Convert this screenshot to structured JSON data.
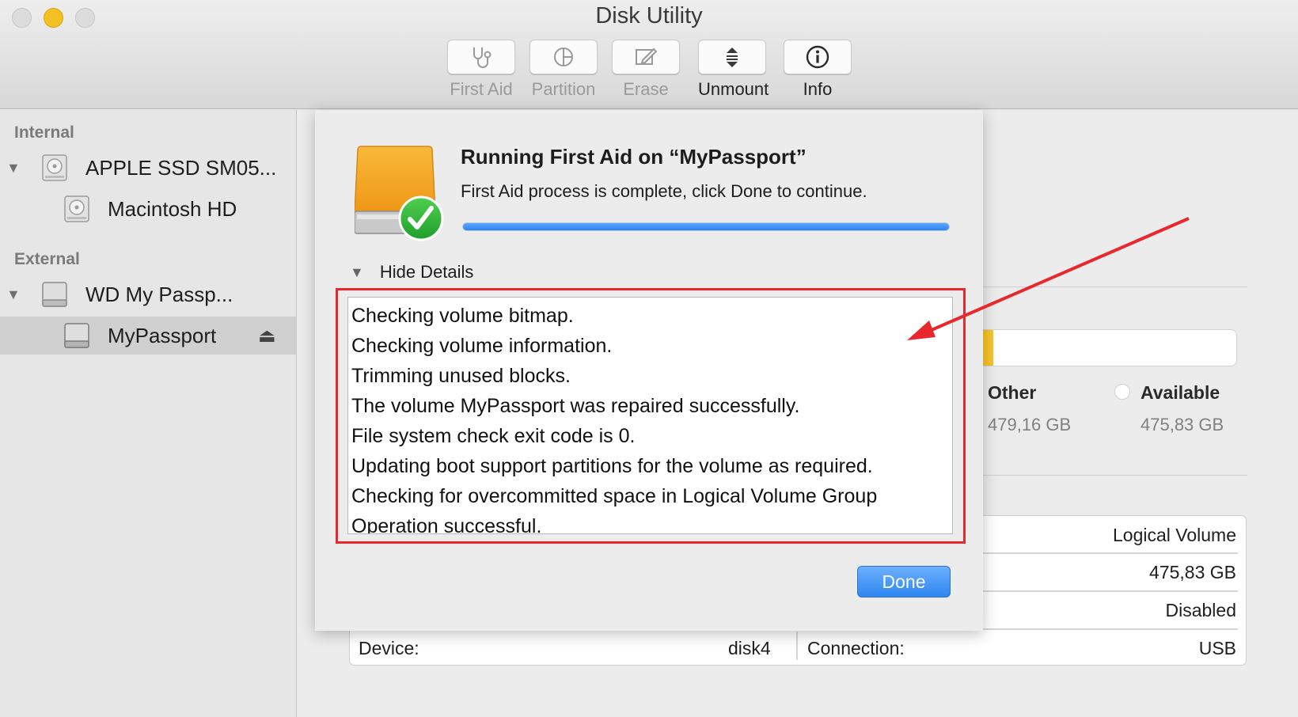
{
  "window": {
    "title": "Disk Utility"
  },
  "toolbar": {
    "items": [
      {
        "label": "First Aid",
        "icon": "stethoscope-icon",
        "enabled": false
      },
      {
        "label": "Partition",
        "icon": "pie-icon",
        "enabled": false
      },
      {
        "label": "Erase",
        "icon": "pencil-icon",
        "enabled": false
      },
      {
        "label": "Unmount",
        "icon": "unmount-icon",
        "enabled": true
      },
      {
        "label": "Info",
        "icon": "info-icon",
        "enabled": true
      }
    ]
  },
  "sidebar": {
    "internal_label": "Internal",
    "external_label": "External",
    "items": [
      {
        "label": "APPLE SSD SM05...",
        "icon": "internal-disk-icon"
      },
      {
        "label": "Macintosh HD",
        "icon": "internal-volume-icon"
      },
      {
        "label": "WD My Passp...",
        "icon": "external-disk-icon"
      },
      {
        "label": "MyPassport",
        "icon": "external-volume-icon",
        "selected": true
      }
    ],
    "eject_icon": "eject-icon"
  },
  "sheet": {
    "title": "Running First Aid on “MyPassport”",
    "message": "First Aid process is complete, click Done to continue.",
    "progress": 1.0,
    "details_toggle": "Hide Details",
    "log": [
      "Checking volume bitmap.",
      "Checking volume information.",
      "Trimming unused blocks.",
      "The volume MyPassport was repaired successfully.",
      "File system check exit code is 0.",
      "Updating boot support partitions for the volume as required.",
      "Checking for overcommitted space in Logical Volume Group",
      "Operation successful."
    ],
    "done_label": "Done"
  },
  "usage": {
    "fill_fraction": 0.15,
    "fill_color": "#f7c52a",
    "other_label": "Other",
    "other_value": "479,16 GB",
    "available_label": "Available",
    "available_value": "475,83 GB"
  },
  "info": {
    "type_value": "Logical Volume",
    "capacity_value": "475,83 GB",
    "owners_value": "Disabled",
    "device_label": "Device:",
    "device_value": "disk4",
    "connection_label": "Connection:",
    "connection_value": "USB"
  },
  "colors": {
    "accent": "#2e84ee",
    "annotation": "#e8282c",
    "check_green": "#2fb43c"
  }
}
